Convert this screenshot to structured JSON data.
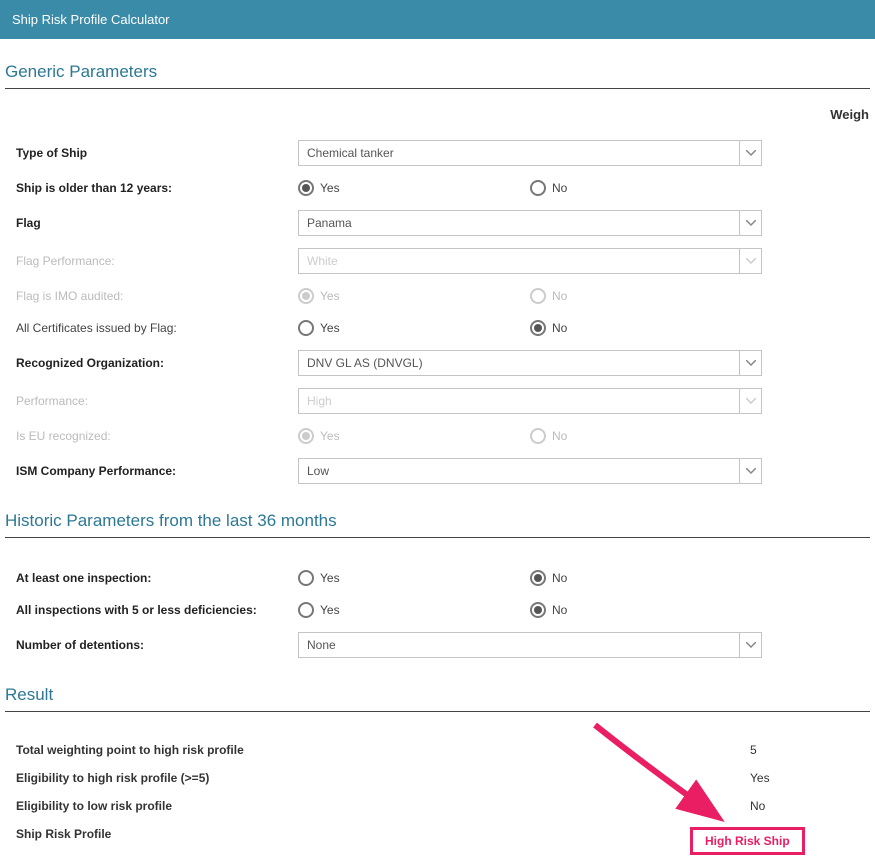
{
  "header": {
    "title": "Ship Risk Profile Calculator"
  },
  "weight_label": "Weigh",
  "sections": {
    "generic": {
      "title": "Generic Parameters"
    },
    "historic": {
      "title": "Historic Parameters from the last 36 months"
    },
    "result": {
      "title": "Result"
    }
  },
  "generic": {
    "type_of_ship": {
      "label": "Type of Ship",
      "value": "Chemical tanker"
    },
    "older_than_12": {
      "label": "Ship is older than 12 years:",
      "yes": "Yes",
      "no": "No",
      "selected": "yes"
    },
    "flag": {
      "label": "Flag",
      "value": "Panama"
    },
    "flag_performance": {
      "label": "Flag Performance:",
      "value": "White"
    },
    "flag_imo_audited": {
      "label": "Flag is IMO audited:",
      "yes": "Yes",
      "no": "No",
      "selected": "yes"
    },
    "all_certs_by_flag": {
      "label": "All Certificates issued by Flag:",
      "yes": "Yes",
      "no": "No",
      "selected": "no"
    },
    "recognized_org": {
      "label": "Recognized Organization:",
      "value": "DNV GL AS (DNVGL)"
    },
    "performance": {
      "label": "Performance:",
      "value": "High"
    },
    "eu_recognized": {
      "label": "Is EU recognized:",
      "yes": "Yes",
      "no": "No",
      "selected": "yes"
    },
    "ism_company_perf": {
      "label": "ISM Company Performance:",
      "value": "Low"
    }
  },
  "historic": {
    "at_least_one_inspection": {
      "label": "At least one inspection:",
      "yes": "Yes",
      "no": "No",
      "selected": "no"
    },
    "all_insp_5_or_less": {
      "label": "All inspections with 5 or less deficiencies:",
      "yes": "Yes",
      "no": "No",
      "selected": "no"
    },
    "number_detentions": {
      "label": "Number of detentions:",
      "value": "None"
    }
  },
  "result": {
    "total_weighting": {
      "label": "Total weighting point to high risk profile",
      "value": "5"
    },
    "eligibility_high": {
      "label": "Eligibility to high risk profile (>=5)",
      "value": "Yes"
    },
    "eligibility_low": {
      "label": "Eligibility to low risk profile",
      "value": "No"
    },
    "ship_risk_profile": {
      "label": "Ship Risk Profile",
      "value": "High Risk Ship"
    }
  }
}
